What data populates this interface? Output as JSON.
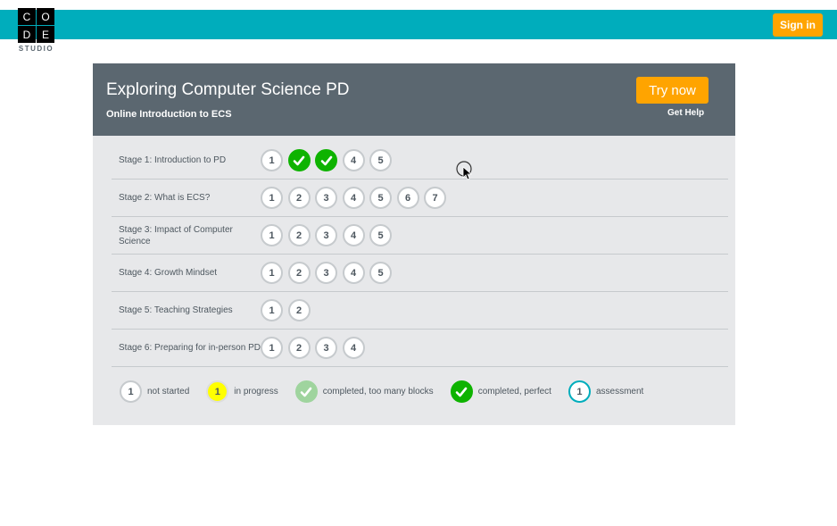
{
  "header": {
    "logo_letters": [
      "C",
      "O",
      "D",
      "E"
    ],
    "logo_sub": "STUDIO",
    "signin_label": "Sign in",
    "brand_color": "#00adbc",
    "accent_color": "#ffa400"
  },
  "course": {
    "title": "Exploring Computer Science PD",
    "subtitle": "Online Introduction to ECS",
    "try_now_label": "Try now",
    "get_help_label": "Get Help"
  },
  "stages": [
    {
      "name": "Stage 1: Introduction to PD",
      "levels": [
        {
          "label": "1",
          "status": "not_started"
        },
        {
          "label": "2",
          "status": "perfect"
        },
        {
          "label": "3",
          "status": "perfect"
        },
        {
          "label": "4",
          "status": "not_started"
        },
        {
          "label": "5",
          "status": "not_started"
        }
      ]
    },
    {
      "name": "Stage 2: What is ECS?",
      "levels": [
        {
          "label": "1",
          "status": "not_started"
        },
        {
          "label": "2",
          "status": "not_started"
        },
        {
          "label": "3",
          "status": "not_started"
        },
        {
          "label": "4",
          "status": "not_started"
        },
        {
          "label": "5",
          "status": "not_started"
        },
        {
          "label": "6",
          "status": "not_started"
        },
        {
          "label": "7",
          "status": "not_started"
        }
      ]
    },
    {
      "name": "Stage 3: Impact of Computer Science",
      "levels": [
        {
          "label": "1",
          "status": "not_started"
        },
        {
          "label": "2",
          "status": "not_started"
        },
        {
          "label": "3",
          "status": "not_started"
        },
        {
          "label": "4",
          "status": "not_started"
        },
        {
          "label": "5",
          "status": "not_started"
        }
      ]
    },
    {
      "name": "Stage 4: Growth Mindset",
      "levels": [
        {
          "label": "1",
          "status": "not_started"
        },
        {
          "label": "2",
          "status": "not_started"
        },
        {
          "label": "3",
          "status": "not_started"
        },
        {
          "label": "4",
          "status": "not_started"
        },
        {
          "label": "5",
          "status": "not_started"
        }
      ]
    },
    {
      "name": "Stage 5: Teaching Strategies",
      "levels": [
        {
          "label": "1",
          "status": "not_started"
        },
        {
          "label": "2",
          "status": "not_started"
        }
      ]
    },
    {
      "name": "Stage 6: Preparing for in-person PD",
      "levels": [
        {
          "label": "1",
          "status": "not_started"
        },
        {
          "label": "2",
          "status": "not_started"
        },
        {
          "label": "3",
          "status": "not_started"
        },
        {
          "label": "4",
          "status": "not_started"
        }
      ]
    }
  ],
  "legend": [
    {
      "label": "not started",
      "status": "not_started",
      "bubble_text": "1"
    },
    {
      "label": "in progress",
      "status": "progress",
      "bubble_text": "1"
    },
    {
      "label": "completed, too many blocks",
      "status": "too_many",
      "bubble_text": ""
    },
    {
      "label": "completed, perfect",
      "status": "perfect",
      "bubble_text": ""
    },
    {
      "label": "assessment",
      "status": "assessment",
      "bubble_text": "1"
    }
  ]
}
